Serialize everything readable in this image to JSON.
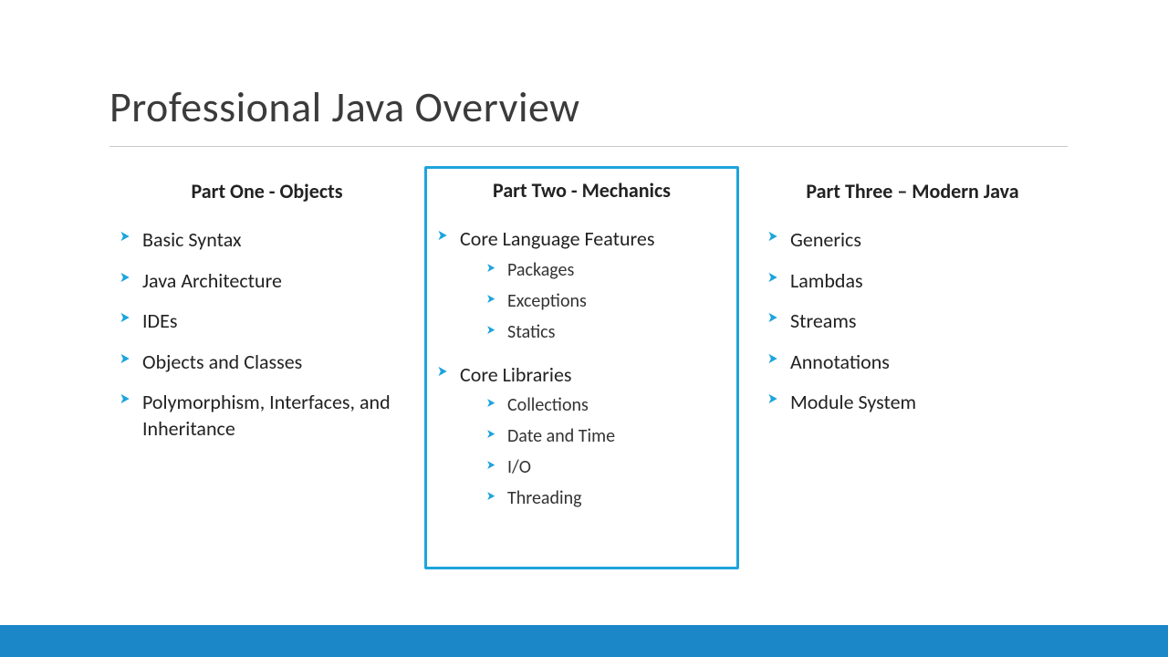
{
  "title": "Professional Java Overview",
  "columns": [
    {
      "heading": "Part One - Objects",
      "highlighted": false,
      "items": [
        {
          "label": "Basic Syntax"
        },
        {
          "label": "Java Architecture"
        },
        {
          "label": "IDEs"
        },
        {
          "label": "Objects and Classes"
        },
        {
          "label": "Polymorphism, Interfaces, and Inheritance"
        }
      ]
    },
    {
      "heading": "Part Two - Mechanics",
      "highlighted": true,
      "items": [
        {
          "label": "Core Language Features",
          "sub": [
            "Packages",
            "Exceptions",
            "Statics"
          ]
        },
        {
          "label": "Core Libraries",
          "sub": [
            "Collections",
            "Date and Time",
            "I/O",
            "Threading"
          ]
        }
      ]
    },
    {
      "heading": "Part Three – Modern Java",
      "highlighted": false,
      "items": [
        {
          "label": "Generics"
        },
        {
          "label": "Lambdas"
        },
        {
          "label": "Streams"
        },
        {
          "label": "Annotations"
        },
        {
          "label": "Module System"
        }
      ]
    }
  ]
}
